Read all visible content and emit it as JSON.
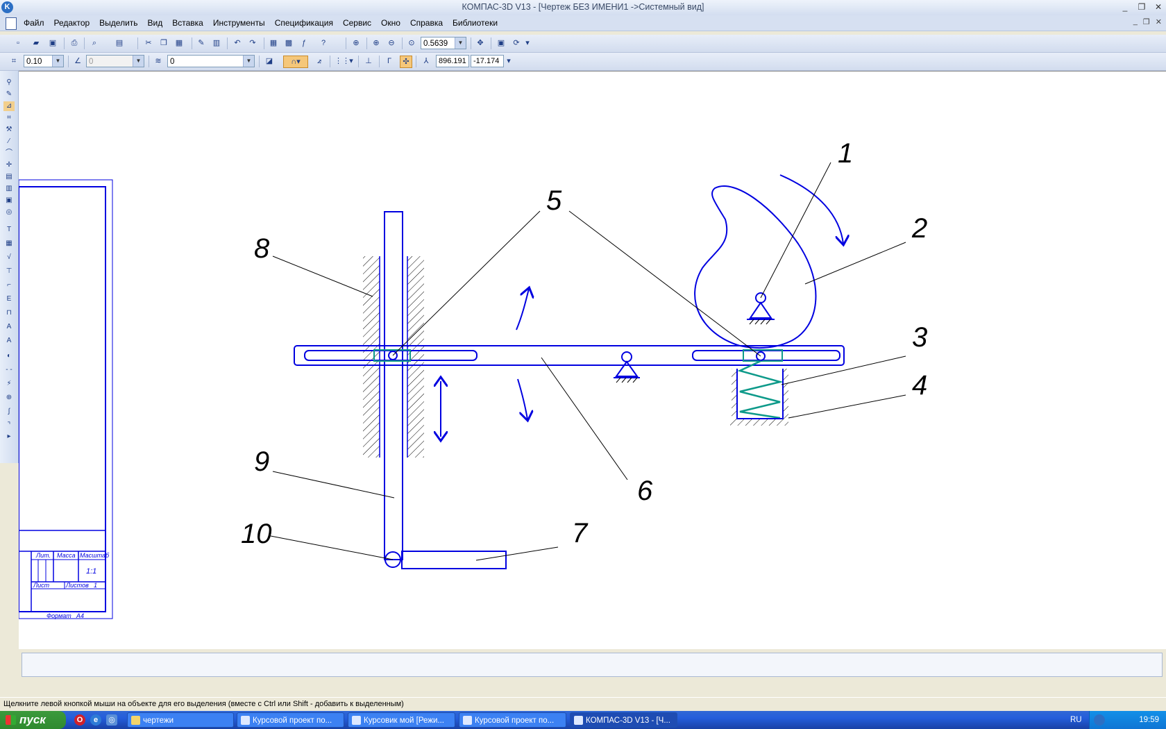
{
  "window": {
    "title": "КОМПАС-3D V13 - [Чертеж БЕЗ ИМЕНИ1 ->Системный вид]",
    "app_icon_letter": "K",
    "controls": [
      "_",
      "❐",
      "✕"
    ]
  },
  "menu": {
    "items": [
      "Файл",
      "Редактор",
      "Выделить",
      "Вид",
      "Вставка",
      "Инструменты",
      "Спецификация",
      "Сервис",
      "Окно",
      "Справка",
      "Библиотеки"
    ],
    "mdi_controls": [
      "_",
      "❐",
      "✕"
    ]
  },
  "toolbar": {
    "zoom_value": "0.5639",
    "step_value": "0.10",
    "angle_value": "0",
    "layer_value": "0",
    "coord_x": "896.191",
    "coord_y": "-17.174"
  },
  "drawing": {
    "labels": [
      "1",
      "2",
      "3",
      "4",
      "5",
      "6",
      "7",
      "8",
      "9",
      "10"
    ],
    "title_block": {
      "lit": "Лит.",
      "massa": "Масса",
      "masshtab": "Масштаб",
      "scale": "1:1",
      "list": "Лист",
      "listov": "Листов",
      "listov_value": "1",
      "format": "Формат",
      "format_value": "A4"
    }
  },
  "status": {
    "hint": "Щелкните левой кнопкой мыши на объекте для его выделения (вместе с Ctrl или Shift - добавить к выделенным)"
  },
  "taskbar": {
    "start_label": "пуск",
    "tasks": [
      "чертежи",
      "Курсовой проект по...",
      "Курсовик мой [Режи...",
      "Курсовой проект по...",
      "КОМПАС-3D V13 - [Ч..."
    ],
    "lang": "RU",
    "clock": "19:59"
  }
}
